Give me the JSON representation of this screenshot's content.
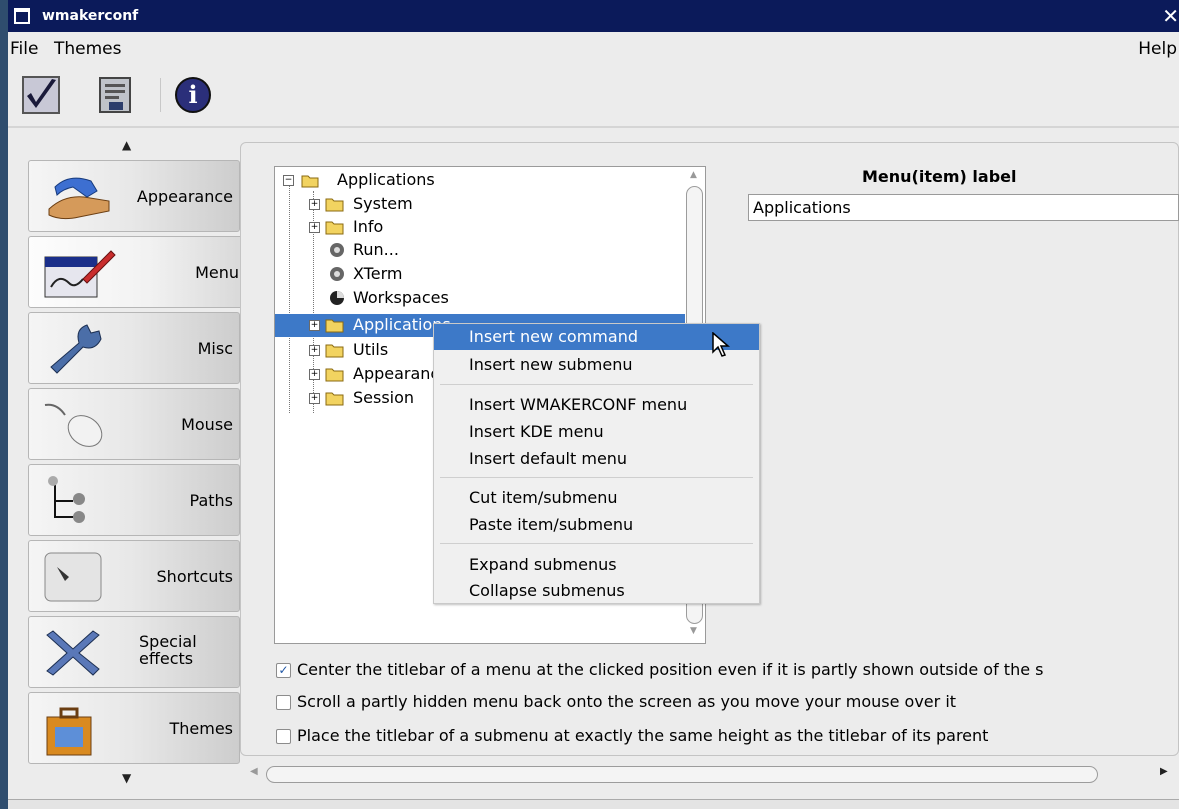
{
  "window": {
    "title": "wmakerconf",
    "close_glyph": "✕"
  },
  "menubar": {
    "file": "File",
    "themes": "Themes",
    "help": "Help"
  },
  "toolbar": {
    "icons": [
      "apply-checkmark-icon",
      "save-document-icon",
      "info-icon"
    ],
    "info_glyph": "i"
  },
  "sidebar": {
    "items": [
      {
        "label": "Appearance",
        "icon": "appearance-hand-icon"
      },
      {
        "label": "Menu",
        "icon": "menu-pencil-icon",
        "active": true
      },
      {
        "label": "Misc",
        "icon": "wrench-icon"
      },
      {
        "label": "Mouse",
        "icon": "mouse-icon"
      },
      {
        "label": "Paths",
        "icon": "paths-tree-icon"
      },
      {
        "label": "Shortcuts",
        "icon": "key-icon"
      },
      {
        "label_line1": "Special",
        "label_line2": "effects",
        "icon": "special-effects-tools-icon"
      },
      {
        "label": "Themes",
        "icon": "themes-suitcase-icon"
      }
    ]
  },
  "tree": {
    "root": "Applications",
    "items": [
      {
        "label": "System",
        "type": "submenu"
      },
      {
        "label": "Info",
        "type": "submenu"
      },
      {
        "label": "Run...",
        "type": "command"
      },
      {
        "label": "XTerm",
        "type": "command"
      },
      {
        "label": "Workspaces",
        "type": "command"
      },
      {
        "label": "Applications",
        "type": "submenu",
        "selected": true
      },
      {
        "label": "Utils",
        "type": "submenu"
      },
      {
        "label": "Appearance",
        "type": "submenu"
      },
      {
        "label": "Session",
        "type": "submenu"
      }
    ],
    "expand_glyph": "+",
    "collapse_glyph": "−"
  },
  "label_editor": {
    "title": "Menu(item) label",
    "value": "Applications"
  },
  "options": [
    {
      "label": "Center the titlebar of a menu at the clicked position even if it is partly shown outside of the s",
      "checked": true
    },
    {
      "label": "Scroll a partly hidden menu back onto the screen as you move your mouse over it",
      "checked": false
    },
    {
      "label": "Place the titlebar of a submenu at exactly the same height as the titlebar of its parent",
      "checked": false
    }
  ],
  "check_glyph": "✓",
  "context_menu": {
    "items": [
      "Insert new command",
      "Insert new submenu",
      "Insert WMAKERCONF menu",
      "Insert KDE menu",
      "Insert default menu",
      "Cut item/submenu",
      "Paste item/submenu",
      "Expand submenus",
      "Collapse submenus"
    ],
    "hovered": "Insert new command"
  },
  "glyphs": {
    "up": "▲",
    "down": "▼",
    "left": "◀",
    "right": "▶"
  },
  "colors": {
    "selection": "#3d79c8",
    "titlebar": "#0b1a5a"
  }
}
